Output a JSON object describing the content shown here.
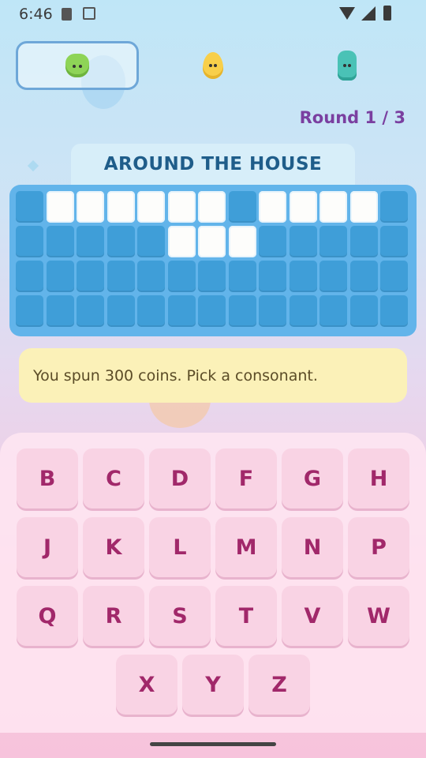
{
  "status_bar": {
    "time": "6:46"
  },
  "players": [
    {
      "name": "green-jelly",
      "icon": "green-jelly-icon",
      "active": true
    },
    {
      "name": "yellow-drop",
      "icon": "yellow-drop-icon",
      "active": false
    },
    {
      "name": "teal-bottle",
      "icon": "teal-bottle-icon",
      "active": false
    }
  ],
  "round_label": "Round 1 / 3",
  "category": "AROUND THE HOUSE",
  "board": {
    "rows": [
      [
        0,
        1,
        1,
        1,
        1,
        1,
        1,
        0,
        1,
        1,
        1,
        1,
        0
      ],
      [
        0,
        0,
        0,
        0,
        0,
        1,
        1,
        1,
        0,
        0,
        0,
        0,
        0
      ],
      [
        0,
        0,
        0,
        0,
        0,
        0,
        0,
        0,
        0,
        0,
        0,
        0,
        0
      ],
      [
        0,
        0,
        0,
        0,
        0,
        0,
        0,
        0,
        0,
        0,
        0,
        0,
        0
      ]
    ]
  },
  "message": "You spun 300 coins. Pick a consonant.",
  "keyboard": {
    "rows": [
      [
        "B",
        "C",
        "D",
        "F",
        "G",
        "H"
      ],
      [
        "J",
        "K",
        "L",
        "M",
        "N",
        "P"
      ],
      [
        "Q",
        "R",
        "S",
        "T",
        "V",
        "W"
      ],
      [
        "X",
        "Y",
        "Z"
      ]
    ]
  },
  "colors": {
    "accent_round": "#7a3fa0",
    "category_text": "#1f5d8a",
    "board_bg": "#62b4ea",
    "key_text": "#a1286a"
  }
}
